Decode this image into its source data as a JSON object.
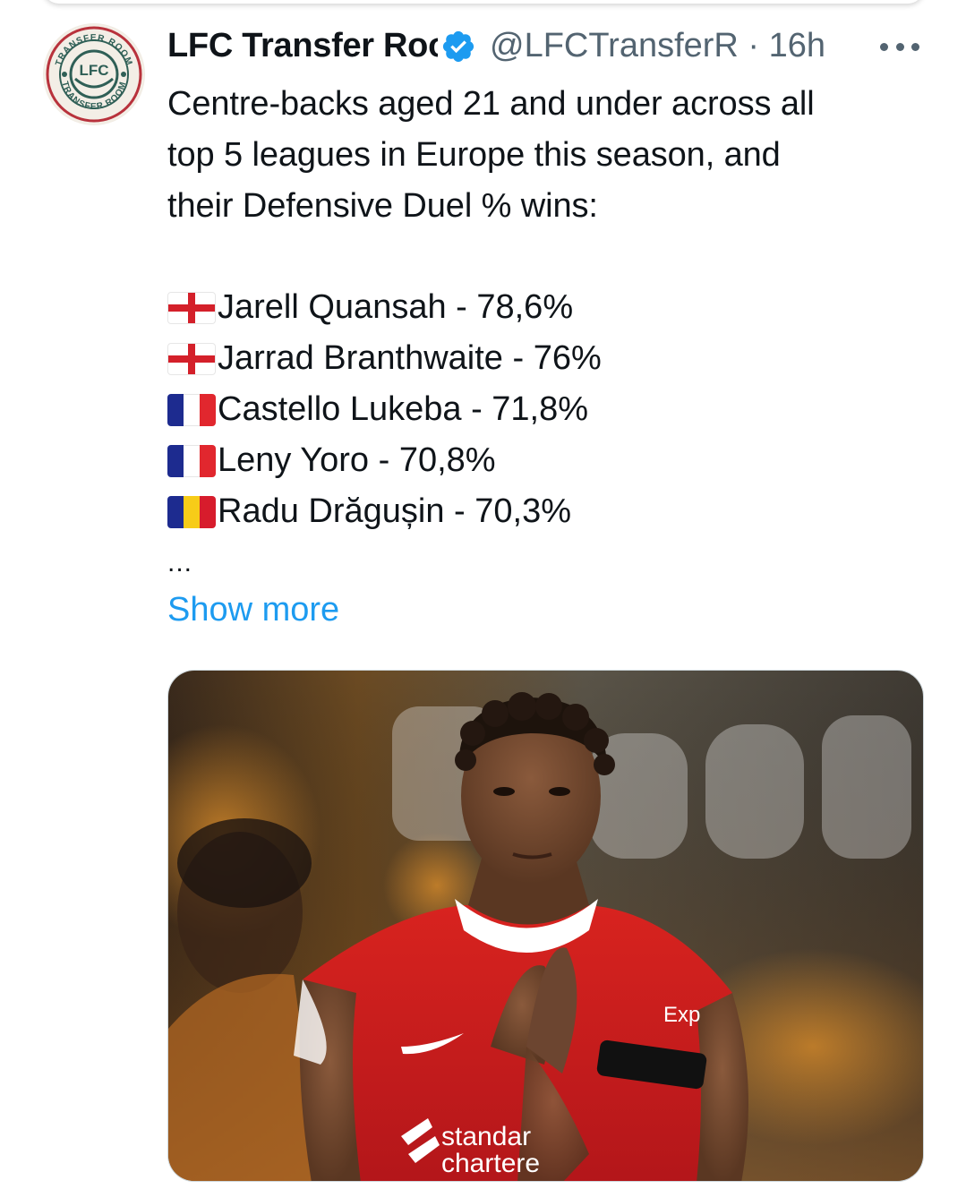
{
  "tweet": {
    "author": {
      "display_name": "LFC Transfer Room",
      "handle": "@LFCTransferR",
      "time": "16h",
      "verified": true,
      "avatar": {
        "ring_text_top": "TRANSFER ROOM",
        "ring_text_bottom": "TRANSFER ROOM",
        "center_text": "LFC"
      }
    },
    "text_lines": [
      "Centre-backs aged 21 and under across all",
      "top 5 leagues in Europe this season, and",
      "their Defensive Duel % wins:"
    ],
    "players": [
      {
        "flag": "england",
        "text": "Jarell Quansah - 78,6%"
      },
      {
        "flag": "england",
        "text": "Jarrad Branthwaite - 76%"
      },
      {
        "flag": "france",
        "text": "Castello Lukeba - 71,8%"
      },
      {
        "flag": "france",
        "text": "Leny Yoro - 70,8%"
      },
      {
        "flag": "romania",
        "text": "Radu Drăgușin - 70,3%"
      }
    ],
    "ellipsis": "...",
    "show_more": "Show more",
    "media": {
      "sponsor_line1": "standar",
      "sponsor_line2": "chartere",
      "sleeve_text": "Exp"
    }
  },
  "colors": {
    "link": "#1d9bf0",
    "verified": "#1d9bf0",
    "secondary_text": "#536471",
    "primary_text": "#0f1419",
    "avatar_ring": "#b8323c",
    "avatar_teal": "#2f5f56"
  }
}
